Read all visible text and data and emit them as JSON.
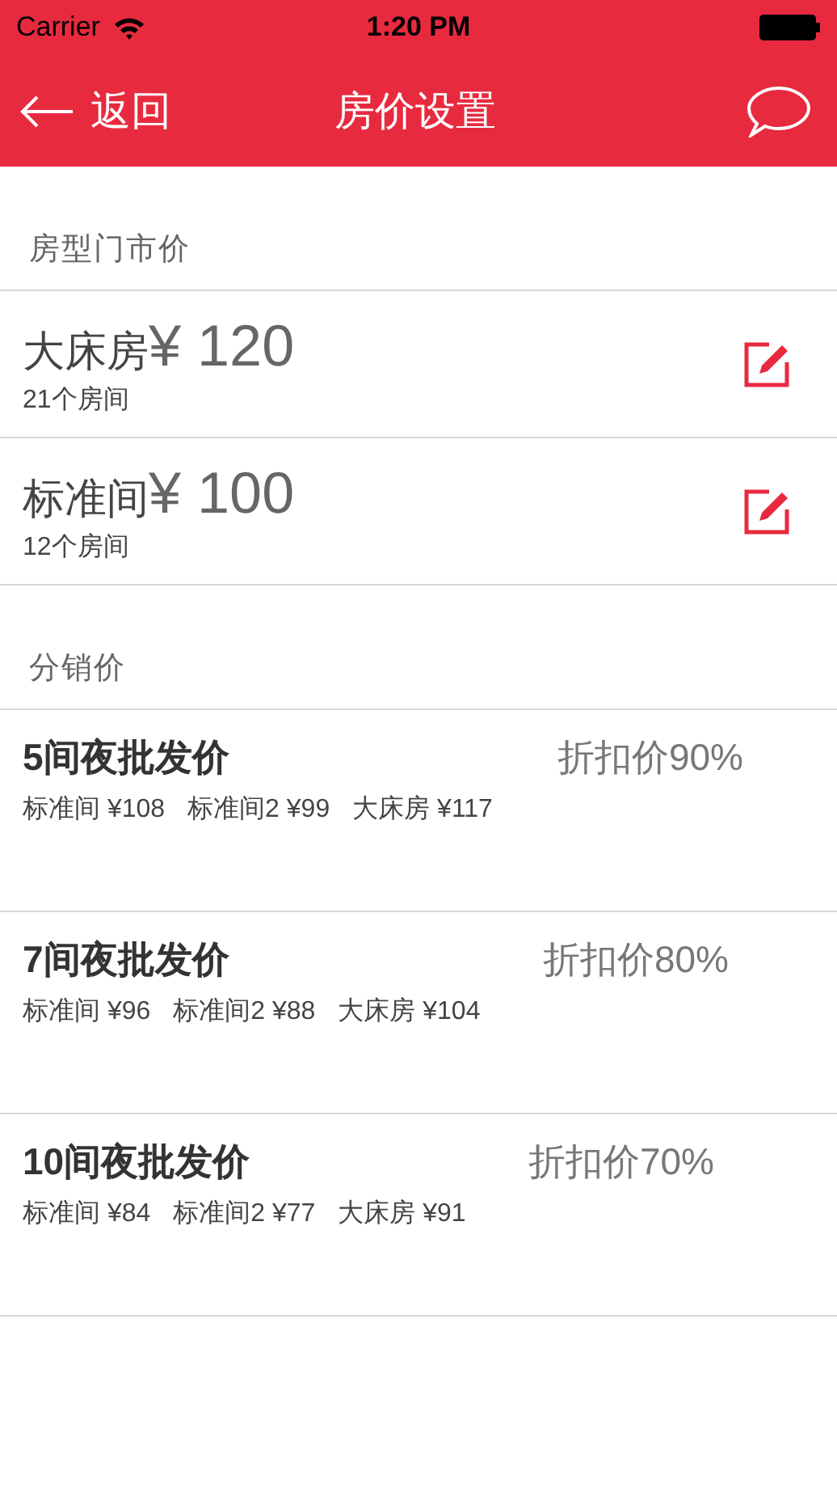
{
  "status_bar": {
    "carrier": "Carrier",
    "time": "1:20 PM"
  },
  "nav": {
    "back": "返回",
    "title": "房价设置"
  },
  "rack_section": {
    "title": "房型门市价",
    "rooms": [
      {
        "name": "大床房",
        "price": "¥ 120",
        "count": "21个房间"
      },
      {
        "name": "标准间",
        "price": "¥ 100",
        "count": "12个房间"
      }
    ]
  },
  "distribution_section": {
    "title": "分销价",
    "tiers": [
      {
        "title": "5间夜批发价",
        "discount": "折扣价90%",
        "prices": [
          "标准间 ¥108",
          "标准间2 ¥99",
          "大床房 ¥117"
        ]
      },
      {
        "title": "7间夜批发价",
        "discount": "折扣价80%",
        "prices": [
          "标准间 ¥96",
          "标准间2 ¥88",
          "大床房 ¥104"
        ]
      },
      {
        "title": "10间夜批发价",
        "discount": "折扣价70%",
        "prices": [
          "标准间 ¥84",
          "标准间2 ¥77",
          "大床房 ¥91"
        ]
      }
    ]
  }
}
